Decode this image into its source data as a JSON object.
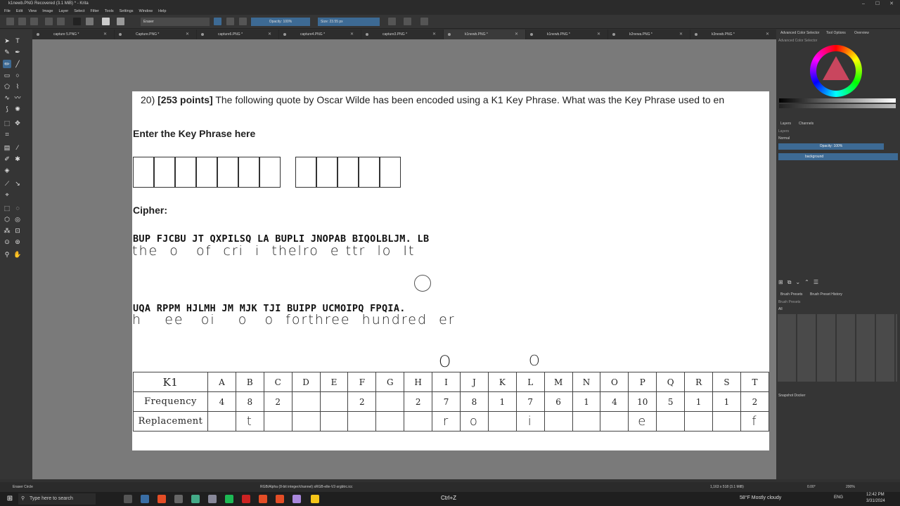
{
  "window": {
    "title": "k1newb.PNG Recovered (3.1 MiB) * - Krita"
  },
  "menu": [
    "File",
    "Edit",
    "View",
    "Image",
    "Layer",
    "Select",
    "Filter",
    "Tools",
    "Settings",
    "Window",
    "Help"
  ],
  "toolbar": {
    "brush_name": "Eraser",
    "opacity": "Opacity: 100%",
    "size": "Size: 23.55 px"
  },
  "tabs": [
    "capture 5.PNG *",
    "Capture.PNG *",
    "capture6.PNG *",
    "capture4.PNG *",
    "capture3.PNG *",
    "k1newb.PNG *",
    "k1newb.PNG *",
    "k2newa.PNG *",
    "k3newb.PNG *"
  ],
  "document": {
    "question_number": "20)",
    "question_points": "[253 points]",
    "question_text": "The following quote by Oscar Wilde has been encoded using a K1 Key Phrase.  What was the Key Phrase used to en",
    "enter_label": "Enter the Key Phrase here",
    "cipher_label": "Cipher:",
    "cipher_line1": "BUP FJCBU JT QXPILSQ LA BUPLI JNOPAB BIQOLBLJM. LB",
    "hand_line1": "the  o   of  cri  i  thelro  e ttr  lo  It",
    "cipher_line2": "UQA RPPM HJLMH JM MJK TJI BUIPP UCMOIPQ FPQIA.",
    "hand_line2": "h    ee   oi    o   o  forthree  hundred  er",
    "above_marks": [
      "O",
      "O"
    ],
    "table": {
      "header_label": "K1",
      "freq_label": "Frequency",
      "repl_label": "Replacement",
      "letters": [
        "A",
        "B",
        "C",
        "D",
        "E",
        "F",
        "G",
        "H",
        "I",
        "J",
        "K",
        "L",
        "M",
        "N",
        "O",
        "P",
        "Q",
        "R",
        "S",
        "T"
      ],
      "frequency": [
        "4",
        "8",
        "2",
        "",
        "",
        "2",
        "",
        "2",
        "7",
        "8",
        "1",
        "7",
        "6",
        "1",
        "4",
        "10",
        "5",
        "1",
        "1",
        "2"
      ],
      "replacement": [
        "",
        "t",
        "",
        "",
        "",
        "",
        "",
        "",
        "r",
        "o",
        "",
        "i",
        "",
        "",
        "",
        "e",
        "",
        "",
        "",
        "f"
      ]
    }
  },
  "right_dock": {
    "color_tabs": [
      "Advanced Color Selector",
      "Tool Options",
      "Overview"
    ],
    "color_title": "Advanced Color Selector",
    "layer_tabs": [
      "Layers",
      "Channels"
    ],
    "layers_title": "Layers",
    "blend_mode": "Normal",
    "layer_opacity": "Opacity: 100%",
    "layer_name": "background",
    "brush_tabs": [
      "Brush Presets",
      "Brush Preset History"
    ],
    "brush_title": "Brush Presets",
    "brush_filter": "All",
    "snapshot": "Snapshot Docker"
  },
  "status": {
    "tool": "Eraser Circle",
    "color_space": "RGB/Alpha (8-bit integer/channel)  sRGB-elle-V2-srgbtrc.icc",
    "dims": "1,163 x 518 (3.1 MiB)",
    "rotation": "0.00°",
    "zoom": "200%"
  },
  "taskbar": {
    "search": "Type here to search",
    "shortcut": "Ctrl+Z",
    "weather": "58°F  Mostly cloudy",
    "lang": "ENG",
    "time": "12:42 PM",
    "date": "3/31/2024"
  },
  "colors": {
    "accent": "#3d6a94",
    "canvas_bg": "#7a7a7a",
    "panel": "#353535"
  }
}
